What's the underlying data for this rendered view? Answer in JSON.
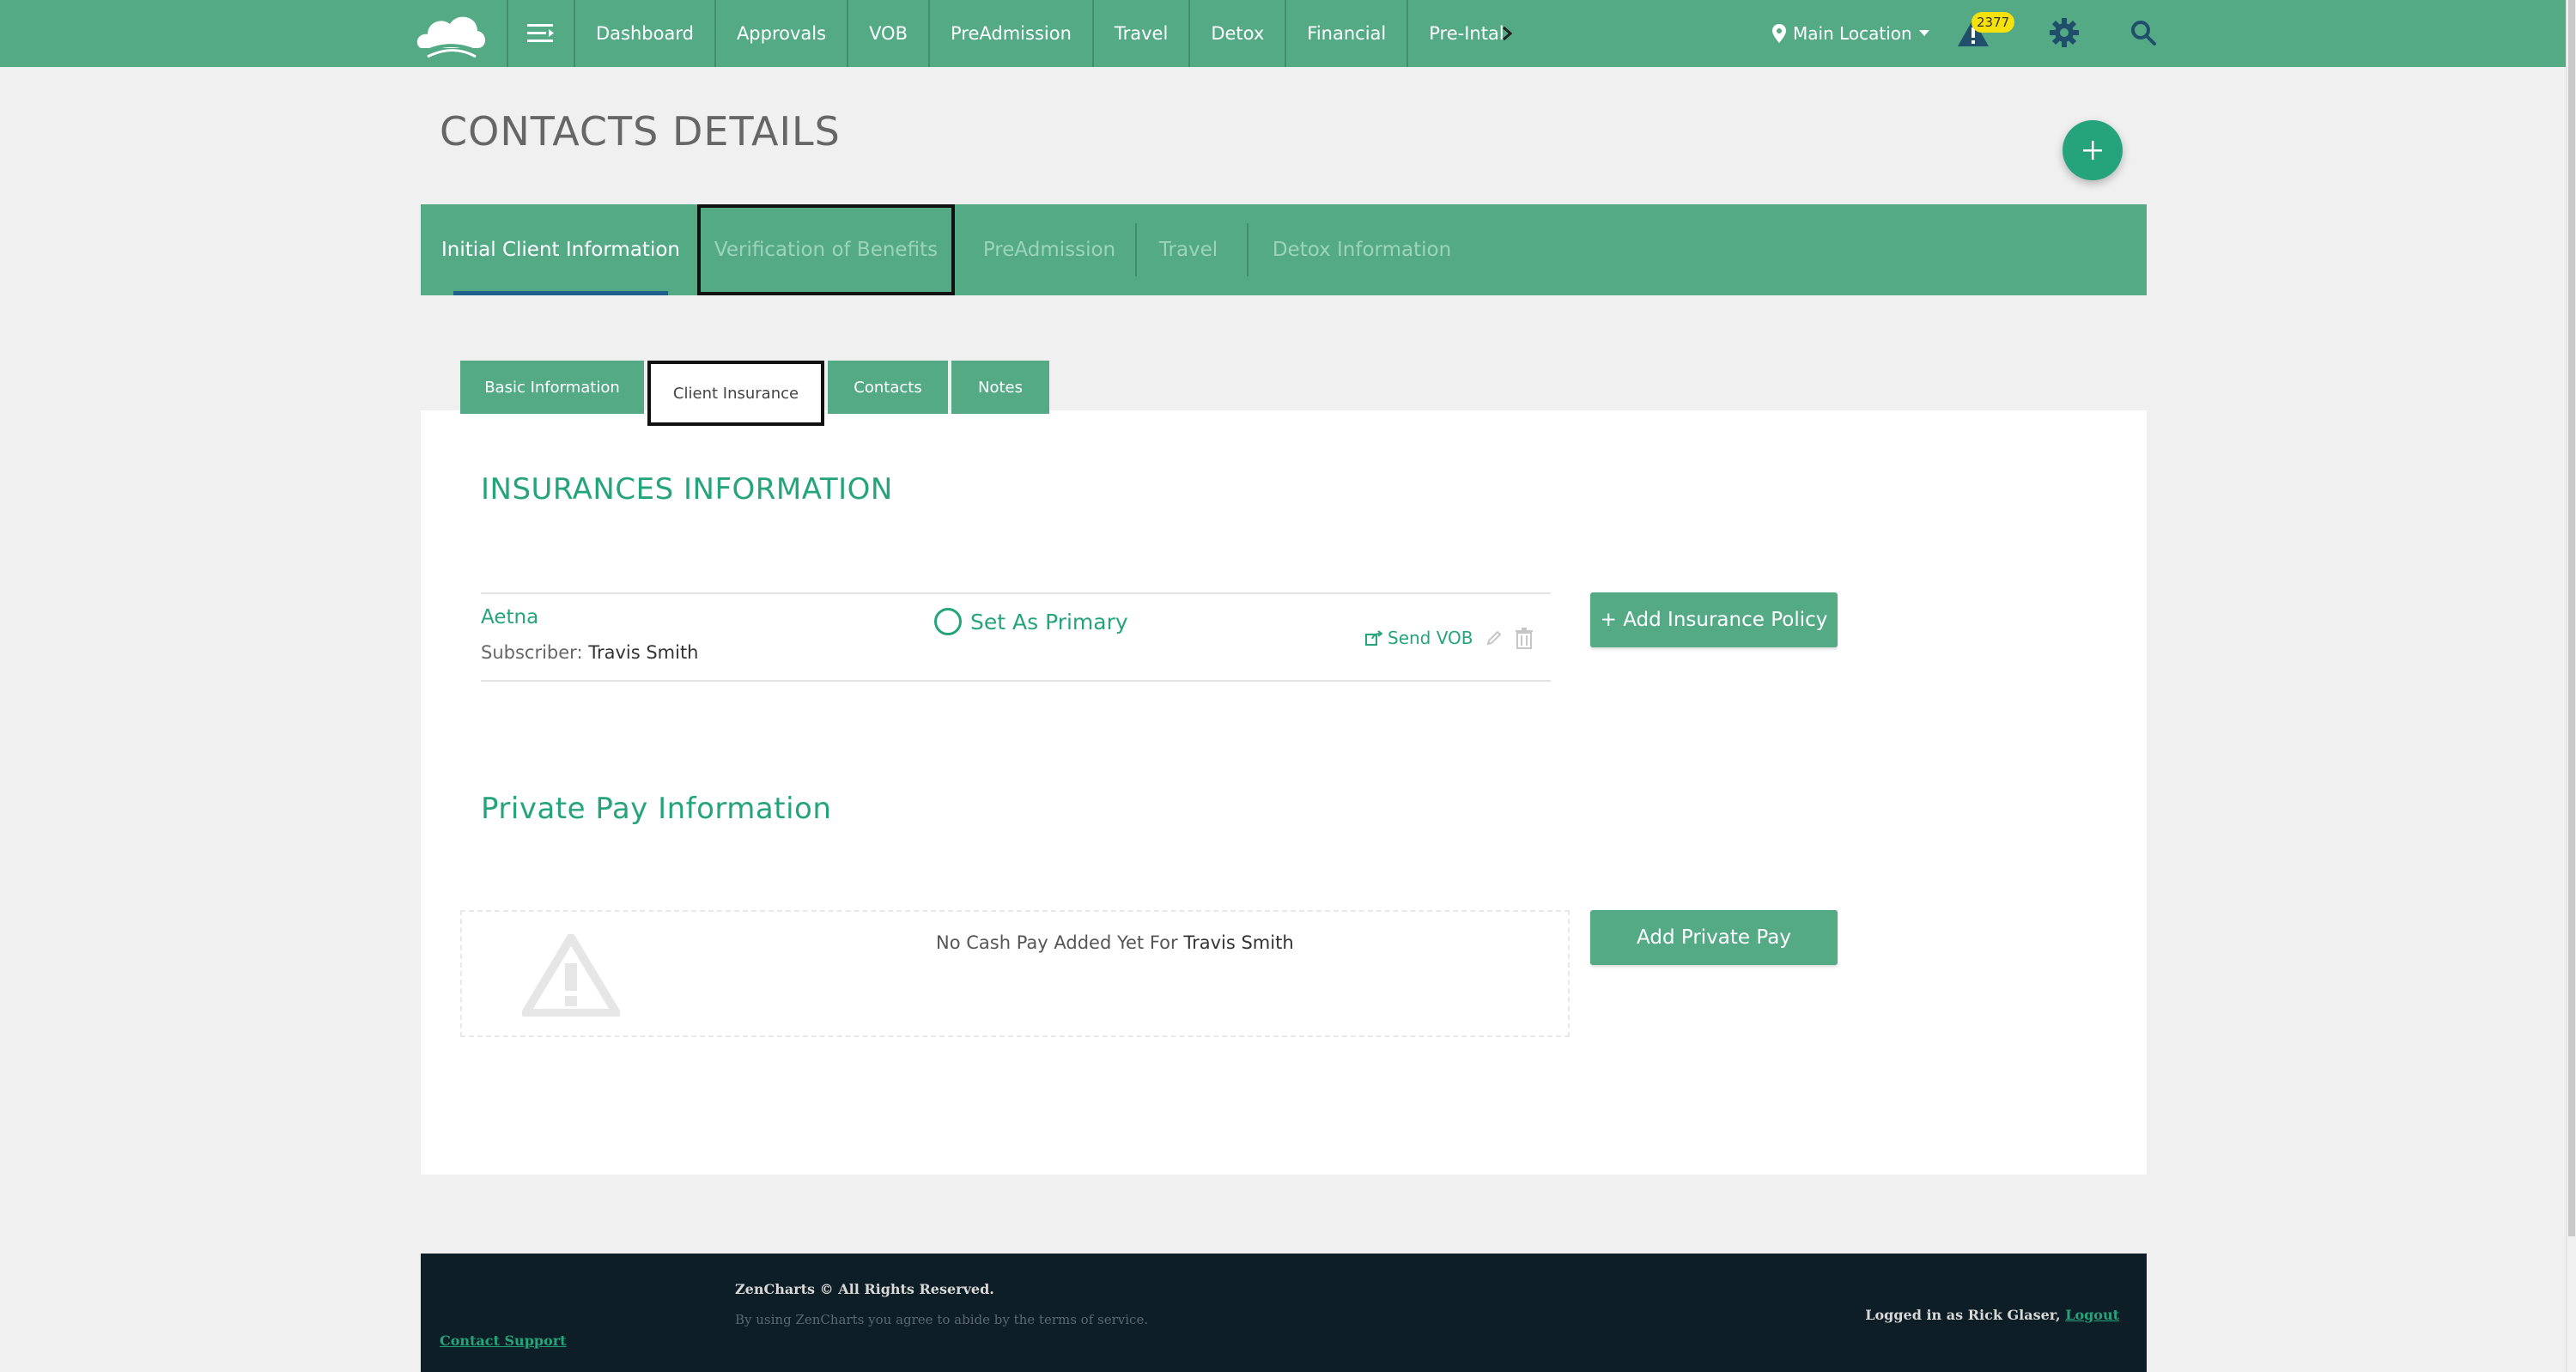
{
  "topnav": {
    "items": [
      "Dashboard",
      "Approvals",
      "VOB",
      "PreAdmission",
      "Travel",
      "Detox",
      "Financial",
      "Pre-Intake"
    ],
    "location": "Main Location",
    "alert_count": "2377",
    "icons": [
      "cloud-logo-icon",
      "hamburger-menu-icon",
      "chevron-right-icon",
      "map-pin-icon",
      "caret-down-icon",
      "alert-triangle-icon",
      "gear-icon",
      "search-icon"
    ]
  },
  "page": {
    "title": "CONTACTS DETAILS"
  },
  "main_tabs": [
    "Initial Client Information",
    "Verification of Benefits",
    "PreAdmission",
    "Travel",
    "Detox Information"
  ],
  "sub_tabs": [
    "Basic Information",
    "Client Insurance",
    "Contacts",
    "Notes"
  ],
  "insurance": {
    "section_title": "INSURANCES INFORMATION",
    "name": "Aetna",
    "subscriber_label": "Subscriber:",
    "subscriber_name": "Travis Smith",
    "set_primary": "Set As Primary",
    "send_vob": "Send VOB",
    "add_button": "+ Add Insurance Policy"
  },
  "private_pay": {
    "section_title": "Private Pay Information",
    "empty_text": "No Cash Pay Added Yet For",
    "client_name": "Travis Smith",
    "add_button": "Add Private Pay"
  },
  "footer": {
    "copyright": "ZenCharts © All Rights Reserved.",
    "terms": "By using ZenCharts you agree to abide by the terms of service.",
    "support": "Contact Support",
    "logged_in": "Logged in as Rick Glaser,",
    "logout": "Logout"
  },
  "colors": {
    "brand": "#55aa86",
    "accent": "#25a47c",
    "footer": "#0e1e26",
    "badge": "#f5e10c"
  }
}
